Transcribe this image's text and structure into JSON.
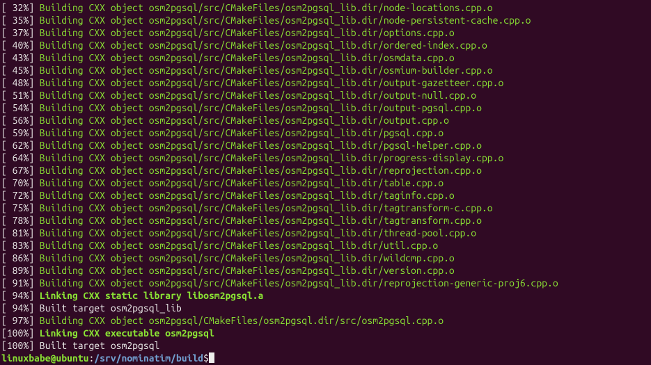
{
  "lines": [
    {
      "type": "build",
      "pct": " 32%",
      "file": "osm2pgsql/src/CMakeFiles/osm2pgsql_lib.dir/node-locations.cpp.o"
    },
    {
      "type": "build",
      "pct": " 35%",
      "file": "osm2pgsql/src/CMakeFiles/osm2pgsql_lib.dir/node-persistent-cache.cpp.o"
    },
    {
      "type": "build",
      "pct": " 37%",
      "file": "osm2pgsql/src/CMakeFiles/osm2pgsql_lib.dir/options.cpp.o"
    },
    {
      "type": "build",
      "pct": " 40%",
      "file": "osm2pgsql/src/CMakeFiles/osm2pgsql_lib.dir/ordered-index.cpp.o"
    },
    {
      "type": "build",
      "pct": " 43%",
      "file": "osm2pgsql/src/CMakeFiles/osm2pgsql_lib.dir/osmdata.cpp.o"
    },
    {
      "type": "build",
      "pct": " 45%",
      "file": "osm2pgsql/src/CMakeFiles/osm2pgsql_lib.dir/osmium-builder.cpp.o"
    },
    {
      "type": "build",
      "pct": " 48%",
      "file": "osm2pgsql/src/CMakeFiles/osm2pgsql_lib.dir/output-gazetteer.cpp.o"
    },
    {
      "type": "build",
      "pct": " 51%",
      "file": "osm2pgsql/src/CMakeFiles/osm2pgsql_lib.dir/output-null.cpp.o"
    },
    {
      "type": "build",
      "pct": " 54%",
      "file": "osm2pgsql/src/CMakeFiles/osm2pgsql_lib.dir/output-pgsql.cpp.o"
    },
    {
      "type": "build",
      "pct": " 56%",
      "file": "osm2pgsql/src/CMakeFiles/osm2pgsql_lib.dir/output.cpp.o"
    },
    {
      "type": "build",
      "pct": " 59%",
      "file": "osm2pgsql/src/CMakeFiles/osm2pgsql_lib.dir/pgsql.cpp.o"
    },
    {
      "type": "build",
      "pct": " 62%",
      "file": "osm2pgsql/src/CMakeFiles/osm2pgsql_lib.dir/pgsql-helper.cpp.o"
    },
    {
      "type": "build",
      "pct": " 64%",
      "file": "osm2pgsql/src/CMakeFiles/osm2pgsql_lib.dir/progress-display.cpp.o"
    },
    {
      "type": "build",
      "pct": " 67%",
      "file": "osm2pgsql/src/CMakeFiles/osm2pgsql_lib.dir/reprojection.cpp.o"
    },
    {
      "type": "build",
      "pct": " 70%",
      "file": "osm2pgsql/src/CMakeFiles/osm2pgsql_lib.dir/table.cpp.o"
    },
    {
      "type": "build",
      "pct": " 72%",
      "file": "osm2pgsql/src/CMakeFiles/osm2pgsql_lib.dir/taginfo.cpp.o"
    },
    {
      "type": "build",
      "pct": " 75%",
      "file": "osm2pgsql/src/CMakeFiles/osm2pgsql_lib.dir/tagtransform-c.cpp.o"
    },
    {
      "type": "build",
      "pct": " 78%",
      "file": "osm2pgsql/src/CMakeFiles/osm2pgsql_lib.dir/tagtransform.cpp.o"
    },
    {
      "type": "build",
      "pct": " 81%",
      "file": "osm2pgsql/src/CMakeFiles/osm2pgsql_lib.dir/thread-pool.cpp.o"
    },
    {
      "type": "build",
      "pct": " 83%",
      "file": "osm2pgsql/src/CMakeFiles/osm2pgsql_lib.dir/util.cpp.o"
    },
    {
      "type": "build",
      "pct": " 86%",
      "file": "osm2pgsql/src/CMakeFiles/osm2pgsql_lib.dir/wildcmp.cpp.o"
    },
    {
      "type": "build",
      "pct": " 89%",
      "file": "osm2pgsql/src/CMakeFiles/osm2pgsql_lib.dir/version.cpp.o"
    },
    {
      "type": "build",
      "pct": " 91%",
      "file": "osm2pgsql/src/CMakeFiles/osm2pgsql_lib.dir/reprojection-generic-proj6.cpp.o"
    },
    {
      "type": "link",
      "pct": " 94%",
      "msg": "Linking CXX static library libosm2pgsql.a"
    },
    {
      "type": "plain",
      "pct": " 94%",
      "msg": "Built target osm2pgsql_lib"
    },
    {
      "type": "build",
      "pct": " 97%",
      "file": "osm2pgsql/CMakeFiles/osm2pgsql.dir/src/osm2pgsql.cpp.o"
    },
    {
      "type": "link",
      "pct": "100%",
      "msg": "Linking CXX executable osm2pgsql"
    },
    {
      "type": "plain",
      "pct": "100%",
      "msg": "Built target osm2pgsql"
    }
  ],
  "build_prefix": "Building CXX object ",
  "prompt": {
    "user": "linuxbabe@ubuntu",
    "sep": ":",
    "path": "/srv/nominatim/build",
    "end": "$"
  }
}
